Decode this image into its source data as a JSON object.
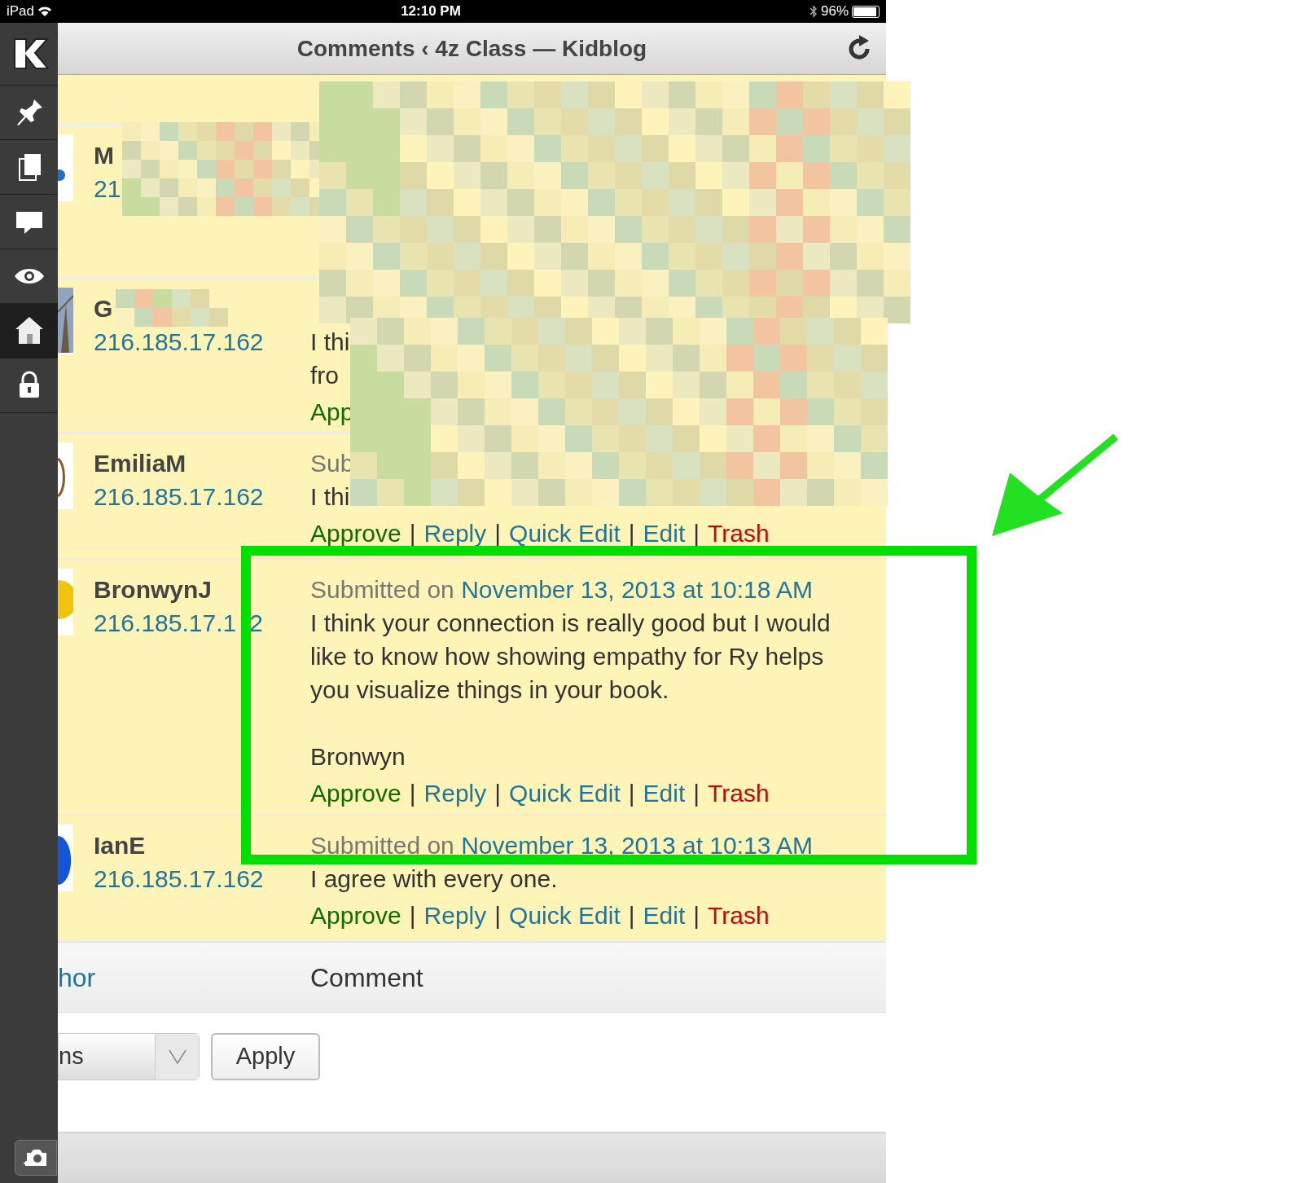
{
  "status_bar": {
    "device": "iPad",
    "time": "12:10 PM",
    "battery": "96%"
  },
  "title": "Comments ‹ 4z Class — Kidblog",
  "sidebar": {
    "items": [
      {
        "kind": "pin",
        "selected": false
      },
      {
        "kind": "pages",
        "selected": false
      },
      {
        "kind": "comment",
        "selected": false
      },
      {
        "kind": "eye",
        "selected": false
      },
      {
        "kind": "home",
        "selected": true
      },
      {
        "kind": "lock",
        "selected": false
      }
    ]
  },
  "comments": [
    {
      "author": "M",
      "ip": "21"
    },
    {
      "author": "G",
      "ip": "216.185.17.162",
      "lines": [
        "I thi",
        "fro"
      ],
      "actions": [
        {
          "label": "App",
          "kind": "approve"
        }
      ]
    },
    {
      "author": "EmiliaM",
      "ip": "216.185.17.162",
      "submitted": "Sub",
      "body": [
        "I thi"
      ],
      "actions": [
        {
          "label": "Approve",
          "kind": "approve"
        },
        {
          "label": "|",
          "kind": "separator"
        },
        {
          "label": "Reply",
          "kind": "link"
        },
        {
          "label": "|",
          "kind": "separator"
        },
        {
          "label": "Quick Edit",
          "kind": "link"
        },
        {
          "label": "|",
          "kind": "separator"
        },
        {
          "label": "Edit",
          "kind": "link"
        },
        {
          "label": "|",
          "kind": "separator"
        },
        {
          "label": "Trash",
          "kind": "trash"
        }
      ]
    },
    {
      "author": "BronwynJ",
      "ip": "216.185.17.1",
      "ip_tail": "2",
      "submitted": "Submitted on",
      "date": "November 13, 2013 at 10:18 AM",
      "body": [
        "I think your connection is really good but I would like to know how showing empathy for Ry helps you visualize things in your book.",
        "Bronwyn"
      ],
      "actions": [
        {
          "label": "Approve",
          "kind": "approve"
        },
        {
          "label": "|",
          "kind": "separator"
        },
        {
          "label": "Reply",
          "kind": "link"
        },
        {
          "label": "|",
          "kind": "separator"
        },
        {
          "label": "Quick Edit",
          "kind": "link"
        },
        {
          "label": "|",
          "kind": "separator"
        },
        {
          "label": "Edit",
          "kind": "link"
        },
        {
          "label": "|",
          "kind": "separator"
        },
        {
          "label": "Trash",
          "kind": "trash"
        }
      ]
    },
    {
      "author": "IanE",
      "ip": "216.185.17.162",
      "submitted": "Submitted on",
      "date": "November 13, 2013 at 10:13 AM",
      "body": [
        "I agree with every one."
      ],
      "actions": [
        {
          "label": "Approve",
          "kind": "approve"
        },
        {
          "label": "|",
          "kind": "separator"
        },
        {
          "label": "Reply",
          "kind": "link"
        },
        {
          "label": "|",
          "kind": "separator"
        },
        {
          "label": "Quick Edit",
          "kind": "link"
        },
        {
          "label": "|",
          "kind": "separator"
        },
        {
          "label": "Edit",
          "kind": "link"
        },
        {
          "label": "|",
          "kind": "separator"
        },
        {
          "label": "Trash",
          "kind": "trash"
        }
      ]
    }
  ],
  "table_footer": {
    "column_1": "hor",
    "column_2": "Comment"
  },
  "bulk_actions": {
    "select_value": "ns",
    "apply": "Apply"
  }
}
